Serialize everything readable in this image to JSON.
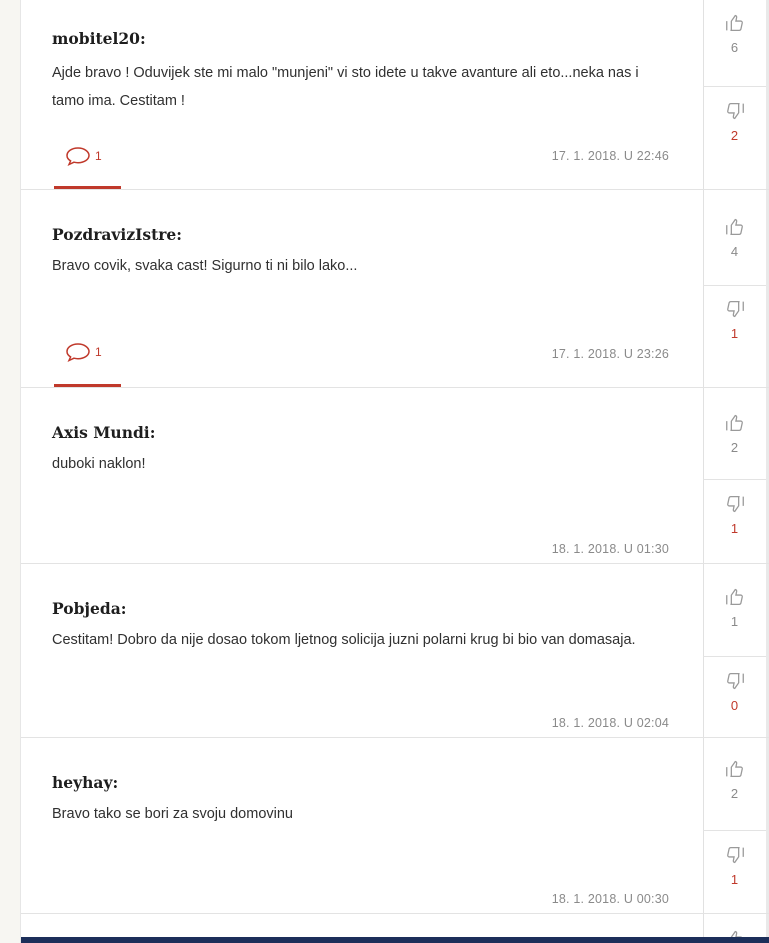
{
  "comments": [
    {
      "author": "mobitel20:",
      "text": "Ajde bravo ! Oduvijek ste mi malo \"munjeni\" vi sto idete u takve avanture ali eto...neka nas i tamo ima. Cestitam !",
      "date": "17. 1. 2018. U 22:46",
      "replies": "1",
      "likes": "6",
      "dislikes": "2"
    },
    {
      "author": "PozdravizIstre:",
      "text": "Bravo covik, svaka cast! Sigurno ti ni bilo lako...",
      "date": "17. 1. 2018. U 23:26",
      "replies": "1",
      "likes": "4",
      "dislikes": "1"
    },
    {
      "author": "Axis Mundi:",
      "text": "duboki naklon!",
      "date": "18. 1. 2018. U 01:30",
      "likes": "2",
      "dislikes": "1"
    },
    {
      "author": "Pobjeda:",
      "text": "Cestitam! Dobro da nije dosao tokom ljetnog solicija juzni polarni krug bi bio van domasaja.",
      "date": "18. 1. 2018. U 02:04",
      "likes": "1",
      "dislikes": "0"
    },
    {
      "author": "heyhay:",
      "text": "Bravo tako se bori za svoju domovinu",
      "date": "18. 1. 2018. U 00:30",
      "likes": "2",
      "dislikes": "1"
    }
  ],
  "colors": {
    "accent": "#c0392b",
    "muted": "#8a8a8a",
    "border": "#e3e3e3"
  },
  "icons": {
    "like": "thumbs-up-icon",
    "dislike": "thumbs-down-icon",
    "reply": "speech-bubble-icon"
  }
}
